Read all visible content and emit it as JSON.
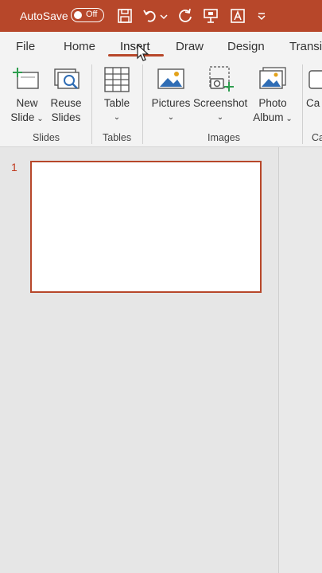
{
  "titlebar": {
    "autosave_label": "AutoSave",
    "autosave_state": "Off",
    "accent_color": "#b7472a",
    "qat_icons": [
      "save-icon",
      "undo-icon",
      "redo-icon",
      "present-icon",
      "text-format-icon",
      "customize-qat-icon"
    ]
  },
  "tabs": [
    {
      "label": "File"
    },
    {
      "label": "Home"
    },
    {
      "label": "Insert",
      "active": true
    },
    {
      "label": "Draw"
    },
    {
      "label": "Design"
    },
    {
      "label": "Transi"
    }
  ],
  "ribbon": {
    "groups": [
      {
        "label": "Slides",
        "buttons": [
          {
            "line1": "New",
            "line2": "Slide"
          },
          {
            "line1": "Reuse",
            "line2": "Slides"
          }
        ]
      },
      {
        "label": "Tables",
        "buttons": [
          {
            "line1": "Table"
          }
        ]
      },
      {
        "label": "Images",
        "buttons": [
          {
            "line1": "Pictures"
          },
          {
            "line1": "Screenshot"
          },
          {
            "line1": "Photo",
            "line2": "Album"
          }
        ]
      },
      {
        "label": "Ca",
        "buttons": [
          {
            "line1": "Ca"
          }
        ]
      }
    ]
  },
  "slides_pane": {
    "slides": [
      {
        "number": "1"
      }
    ]
  }
}
